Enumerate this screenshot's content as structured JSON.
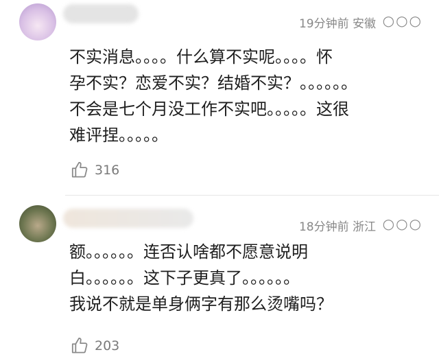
{
  "comments": [
    {
      "meta": "19分钟前 安徽",
      "more": "○○○",
      "lines": [
        "不实消息。。。。什么算不实呢。。。。怀",
        "孕不实？恋爱不实？结婚不实？。。。。。。",
        "不会是七个月没工作不实吧。。。。。这很",
        "难评捏。。。。。"
      ],
      "likes": "316"
    },
    {
      "meta": "18分钟前 浙江",
      "more": "○○○",
      "lines": [
        "额。。。。。。连否认啥都不愿意说明",
        "白。。。。。。这下子更真了。。。。。。",
        "我说不就是单身俩字有那么烫嘴吗？"
      ],
      "likes": "203"
    }
  ]
}
